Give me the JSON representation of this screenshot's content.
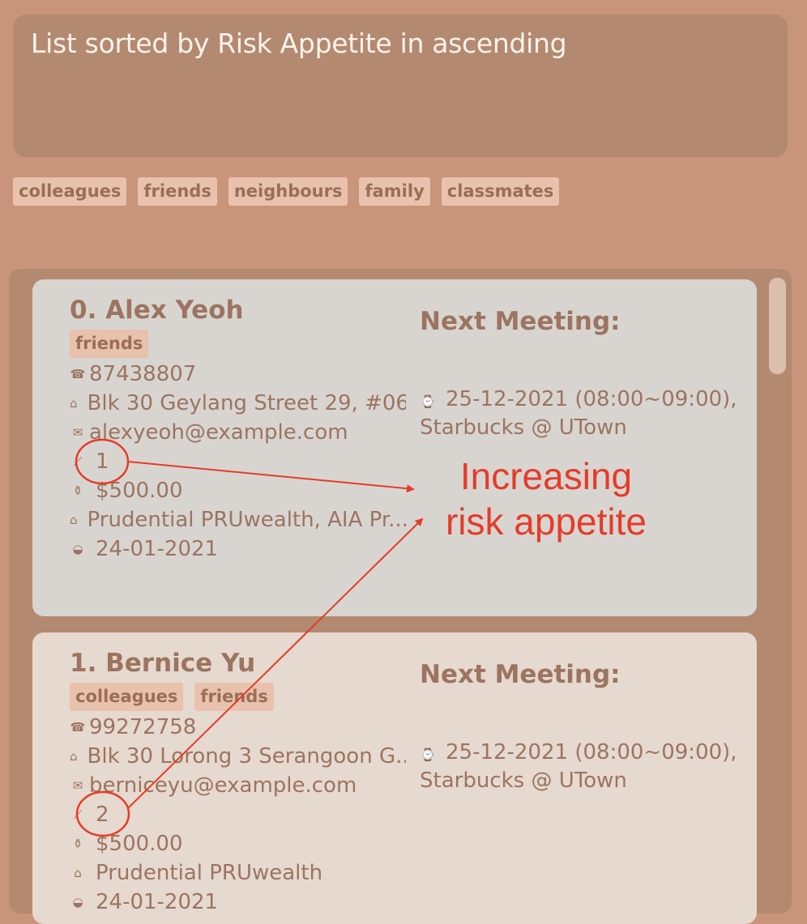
{
  "result_display": {
    "text": "List sorted by Risk Appetite in ascending"
  },
  "tag_filters": [
    "colleagues",
    "friends",
    "neighbours",
    "family",
    "classmates"
  ],
  "clients": [
    {
      "name": "0.  Alex Yeoh",
      "tags": [
        "friends"
      ],
      "phone": "87438807",
      "address": "Blk 30 Geylang Street 29, #06...",
      "email": "alexyeoh@example.com",
      "risk_appetite": "1",
      "disposable_income": "$500.00",
      "current_plans": "Prudential PRUwealth, AIA Pr...",
      "last_met": "24-01-2021",
      "next_meeting_title": "Next Meeting:",
      "next_meeting_line1": "25-12-2021 (08:00~09:00),",
      "next_meeting_line2": "Starbucks @ UTown"
    },
    {
      "name": "1.  Bernice Yu",
      "tags": [
        "colleagues",
        "friends"
      ],
      "phone": "99272758",
      "address": "Blk 30 Lorong 3 Serangoon G...",
      "email": "berniceyu@example.com",
      "risk_appetite": "2",
      "disposable_income": "$500.00",
      "current_plans": "Prudential PRUwealth",
      "last_met": "24-01-2021",
      "next_meeting_title": "Next Meeting:",
      "next_meeting_line1": "25-12-2021 (08:00~09:00),",
      "next_meeting_line2": "Starbucks @ UTown"
    }
  ],
  "annotation": {
    "line1": "Increasing",
    "line2": "risk appetite",
    "color": "#e53c29"
  },
  "icons": {
    "phone": "☎",
    "address": "⌂",
    "email": "✉",
    "risk": "⟋",
    "income": "⚱",
    "plans": "⌂",
    "last_met": "◒",
    "meeting": "⌚"
  },
  "colors": {
    "background": "#c9957a",
    "panel": "#b38a70",
    "card_selected": "#d8d5d1",
    "card": "#e6d9cf",
    "chip": "#e8c2ac",
    "text": "#9c7460"
  }
}
